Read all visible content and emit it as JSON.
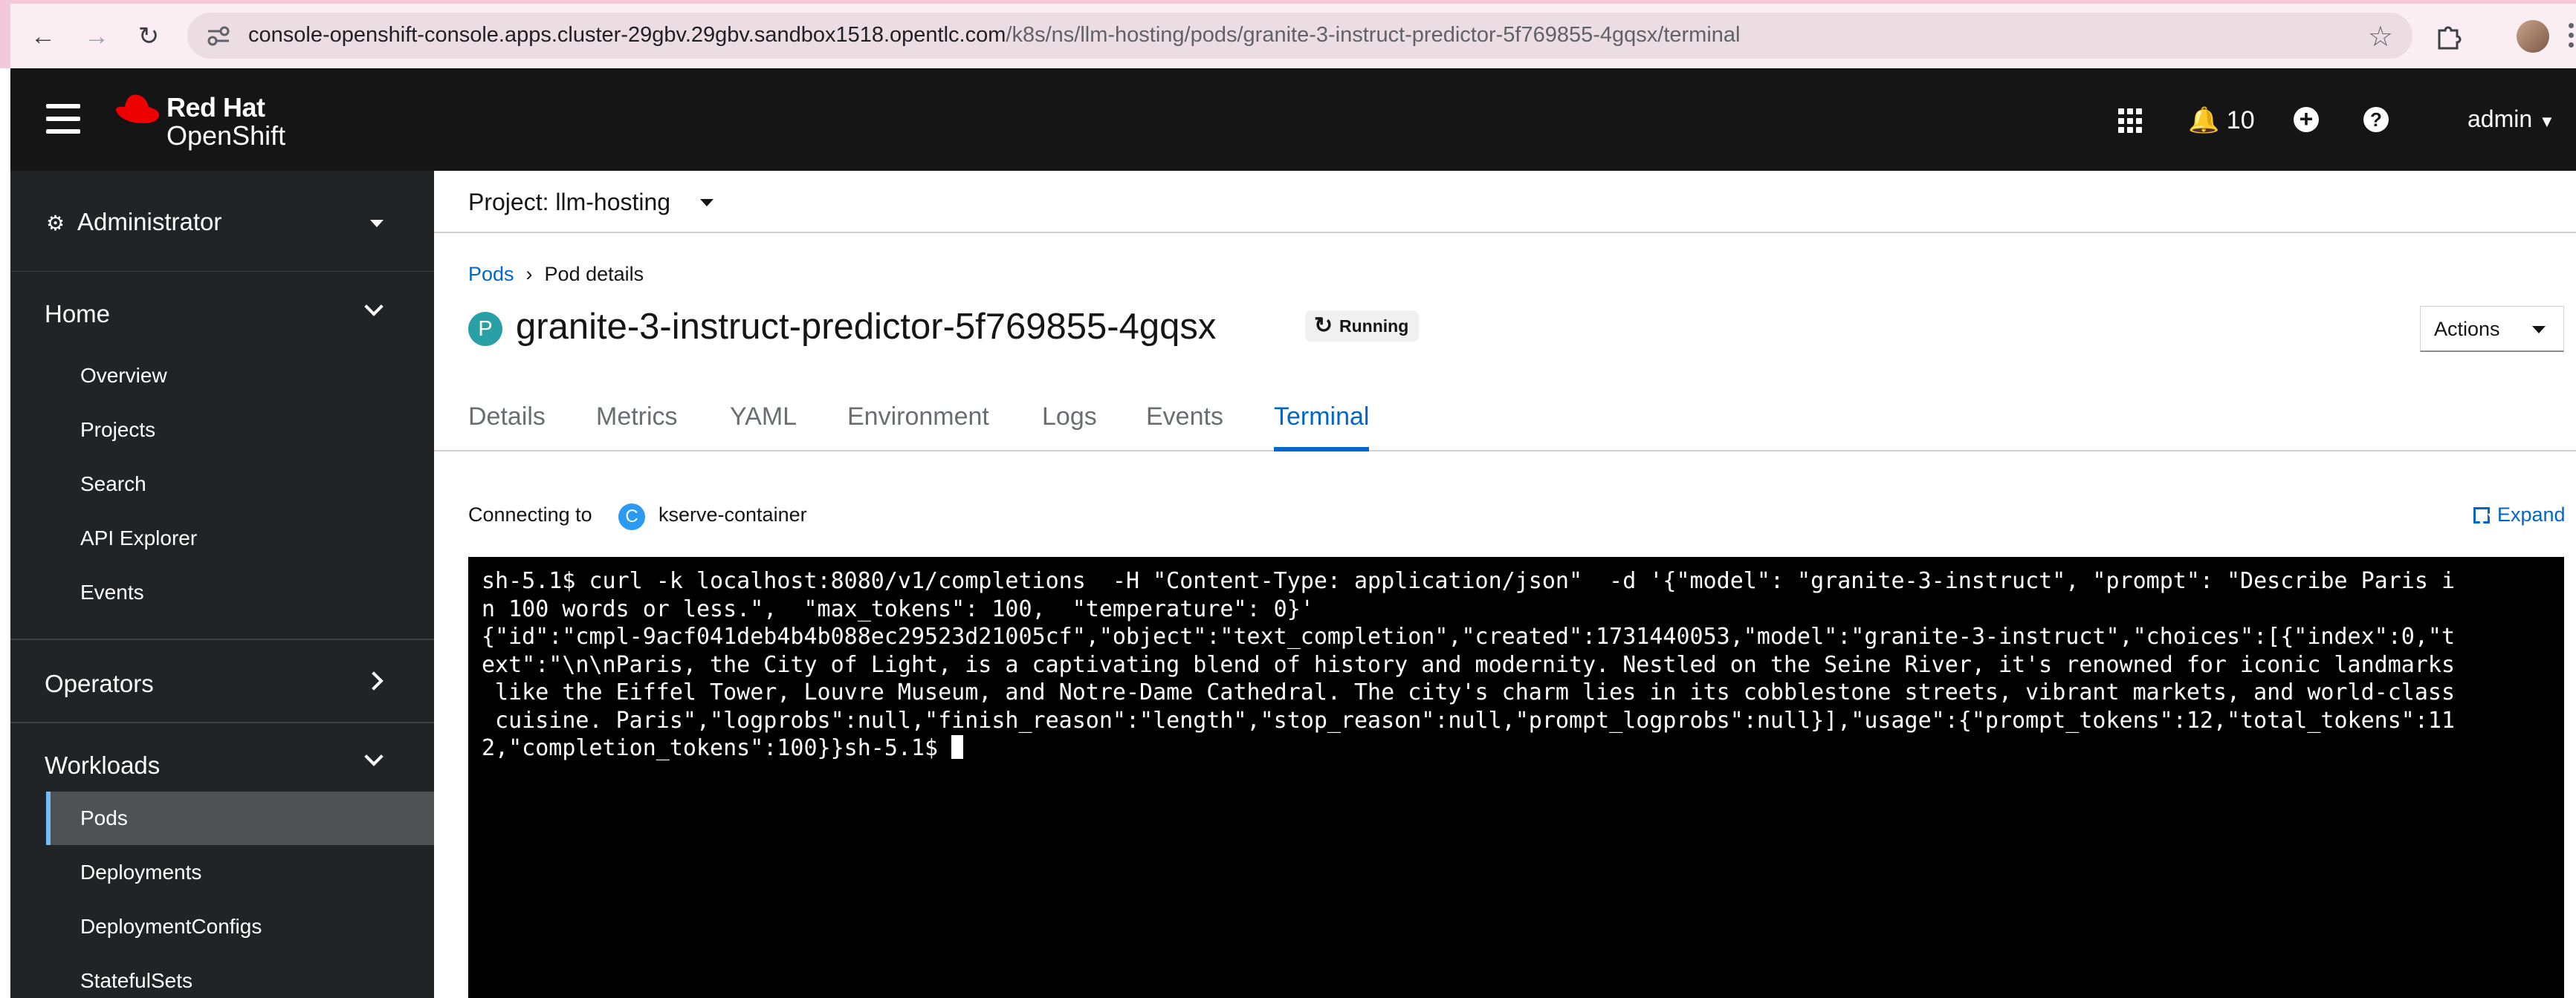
{
  "browser": {
    "url_host": "console-openshift-console.apps.cluster-29gbv.29gbv.sandbox1518.opentlc.com",
    "url_path": "/k8s/ns/llm-hosting/pods/granite-3-instruct-predictor-5f769855-4gqsx/terminal"
  },
  "masthead": {
    "brand_line1": "Red Hat",
    "brand_line2": "OpenShift",
    "notifications_count": "10",
    "user": "admin"
  },
  "sidebar": {
    "perspective": "Administrator",
    "sections": {
      "home": {
        "title": "Home",
        "items": [
          "Overview",
          "Projects",
          "Search",
          "API Explorer",
          "Events"
        ]
      },
      "operators": {
        "title": "Operators"
      },
      "workloads": {
        "title": "Workloads",
        "items": [
          "Pods",
          "Deployments",
          "DeploymentConfigs",
          "StatefulSets"
        ]
      }
    }
  },
  "main": {
    "project_label": "Project: llm-hosting",
    "breadcrumb": {
      "link": "Pods",
      "current": "Pod details"
    },
    "pod_badge": "P",
    "pod_name": "granite-3-instruct-predictor-5f769855-4gqsx",
    "status": "Running",
    "actions_label": "Actions",
    "tabs": [
      "Details",
      "Metrics",
      "YAML",
      "Environment",
      "Logs",
      "Events",
      "Terminal"
    ],
    "active_tab": "Terminal",
    "connecting_label": "Connecting to",
    "container_badge": "C",
    "container_name": "kserve-container",
    "expand_label": "Expand",
    "terminal_lines": [
      "sh-5.1$ curl -k localhost:8080/v1/completions  -H \"Content-Type: application/json\"  -d '{\"model\": \"granite-3-instruct\", \"prompt\": \"Describe Paris i",
      "n 100 words or less.\",  \"max_tokens\": 100,  \"temperature\": 0}'",
      "{\"id\":\"cmpl-9acf041deb4b4b088ec29523d21005cf\",\"object\":\"text_completion\",\"created\":1731440053,\"model\":\"granite-3-instruct\",\"choices\":[{\"index\":0,\"t",
      "ext\":\"\\n\\nParis, the City of Light, is a captivating blend of history and modernity. Nestled on the Seine River, it's renowned for iconic landmarks",
      " like the Eiffel Tower, Louvre Museum, and Notre-Dame Cathedral. The city's charm lies in its cobblestone streets, vibrant markets, and world-class",
      " cuisine. Paris\",\"logprobs\":null,\"finish_reason\":\"length\",\"stop_reason\":null,\"prompt_logprobs\":null}],\"usage\":{\"prompt_tokens\":12,\"total_tokens\":11",
      "2,\"completion_tokens\":100}}sh-5.1$ "
    ]
  }
}
